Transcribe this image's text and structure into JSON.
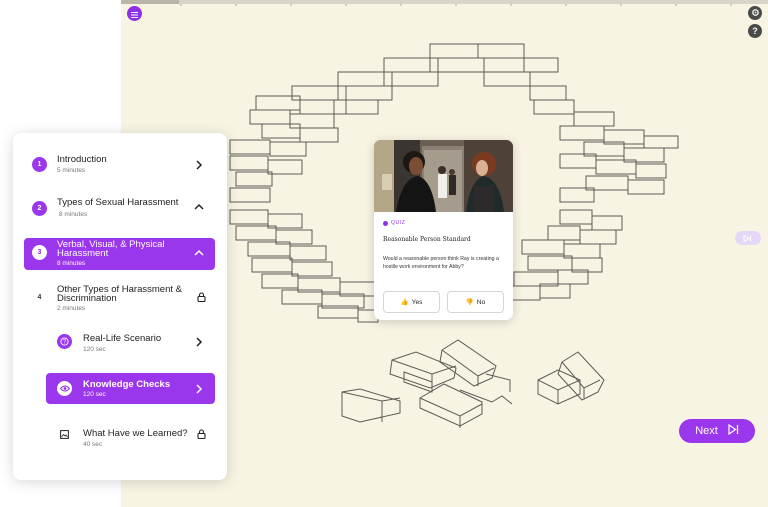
{
  "header": {
    "menu_icon": "hamburger-menu-icon",
    "settings_icon": "gear-icon",
    "help_label": "?",
    "progress": 0.09
  },
  "quiz_card": {
    "tag": "QUIZ",
    "title": "Reasonable Person Standard",
    "question": "Would a reasonable person think Ray is creating a hostile work environment for Abby?",
    "answers": [
      {
        "label": "Yes",
        "icon": "thumbs-up-icon",
        "glyph": "👍"
      },
      {
        "label": "No",
        "icon": "thumbs-down-icon",
        "glyph": "👎"
      }
    ]
  },
  "navigation": {
    "next_label": "Next"
  },
  "colors": {
    "accent": "#9a36ec",
    "stage_background": "#f8f4e3"
  },
  "course_outline": {
    "modules": [
      {
        "number": "1",
        "title": "Introduction",
        "duration": "5 minutes",
        "state": "collapsed"
      },
      {
        "number": "2",
        "title": "Types of Sexual Harassment",
        "duration": "8 minutes",
        "state": "expanded"
      },
      {
        "number": "3",
        "title": "Verbal, Visual, & Physical Harassment",
        "duration": "8 minutes",
        "state": "active"
      },
      {
        "number": "4",
        "title": "Other Types of Harassment & Discrimination",
        "duration": "2 minutes",
        "state": "locked"
      }
    ],
    "lessons": [
      {
        "title": "Real-Life Scenario",
        "duration": "120 sec",
        "icon": "question-icon",
        "state": "available"
      },
      {
        "title": "Knowledge Checks",
        "duration": "120 sec",
        "icon": "eye-icon",
        "state": "active"
      },
      {
        "title": "What Have we Learned?",
        "duration": "40 sec",
        "icon": "image-icon",
        "state": "locked"
      }
    ]
  }
}
